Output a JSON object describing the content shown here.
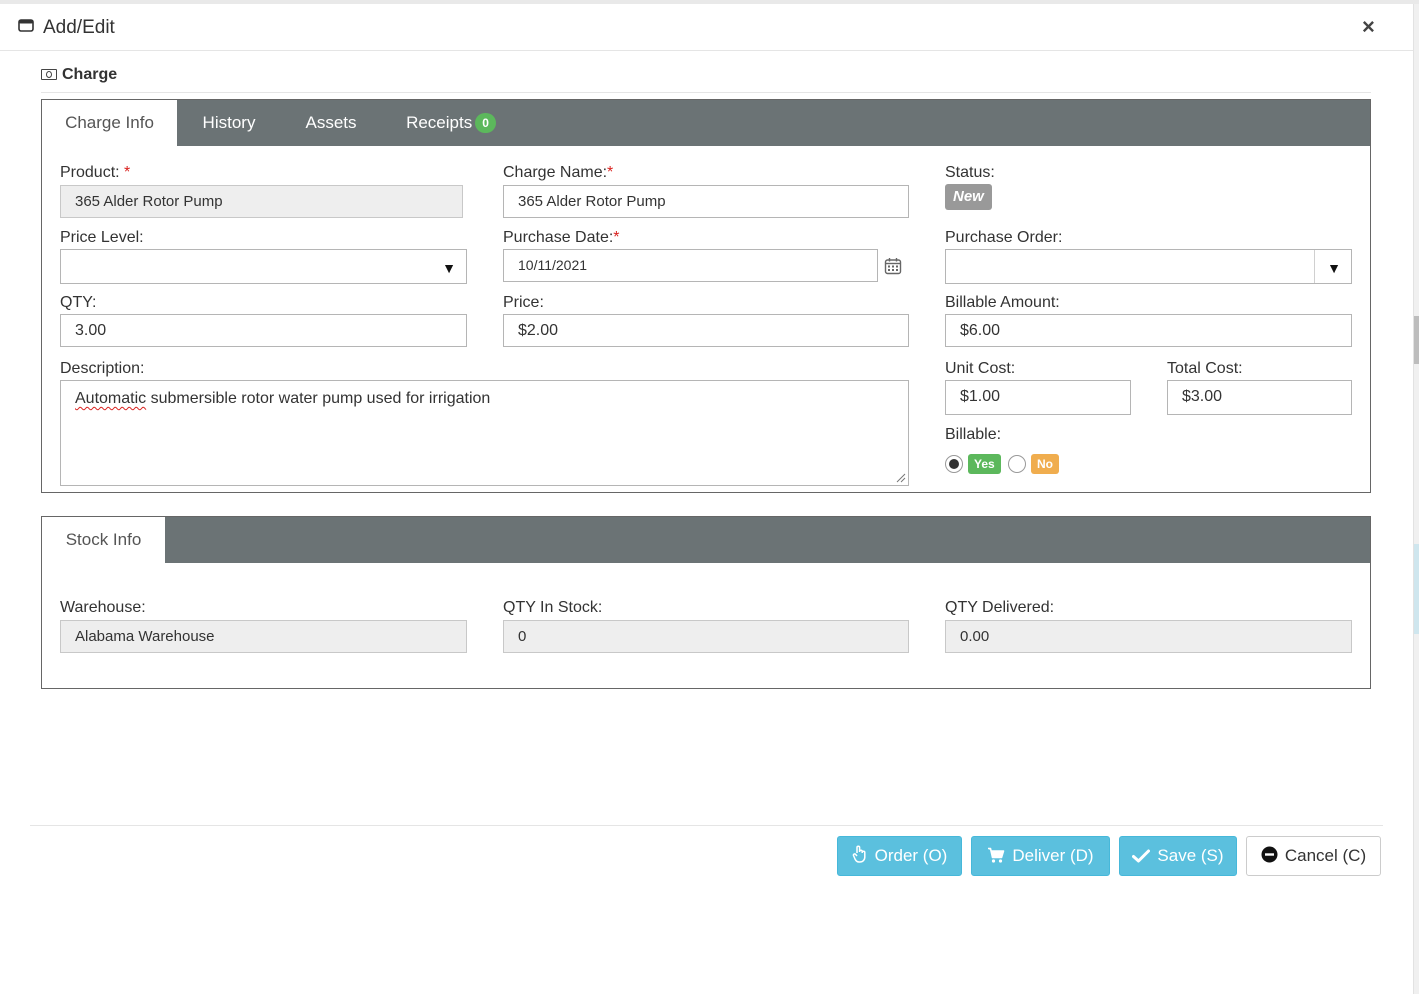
{
  "window": {
    "title": "Add/Edit",
    "close_glyph": "×",
    "icon": "window-icon"
  },
  "section": {
    "title": "Charge",
    "icon": "money-icon"
  },
  "tabs": [
    {
      "label": "Charge Info",
      "active": true
    },
    {
      "label": "History",
      "active": false
    },
    {
      "label": "Assets",
      "active": false
    },
    {
      "label": "Receipts",
      "active": false,
      "badge": "0"
    }
  ],
  "form": {
    "product": {
      "label": "Product:",
      "required": "*",
      "value": "365 Alder Rotor Pump"
    },
    "charge_name": {
      "label": "Charge Name:",
      "required": "*",
      "value": "365 Alder Rotor Pump"
    },
    "status": {
      "label": "Status:",
      "value": "New"
    },
    "price_level": {
      "label": "Price Level:",
      "value": ""
    },
    "purchase_date": {
      "label": "Purchase Date:",
      "required": "*",
      "value": "10/11/2021"
    },
    "purchase_order": {
      "label": "Purchase Order:",
      "value": ""
    },
    "qty": {
      "label": "QTY:",
      "value": "3.00"
    },
    "price": {
      "label": "Price:",
      "value": "$2.00"
    },
    "billable_amount": {
      "label": "Billable Amount:",
      "value": "$6.00"
    },
    "description": {
      "label": "Description:",
      "misspelled": "Automatic",
      "value_rest": " submersible rotor water pump used for irrigation"
    },
    "unit_cost": {
      "label": "Unit Cost:",
      "value": "$1.00"
    },
    "total_cost": {
      "label": "Total Cost:",
      "value": "$3.00"
    },
    "billable": {
      "label": "Billable:",
      "yes": "Yes",
      "no": "No",
      "selected": "Yes"
    }
  },
  "stock_tabs": [
    {
      "label": "Stock Info",
      "active": true
    }
  ],
  "stock": {
    "warehouse": {
      "label": "Warehouse:",
      "value": "Alabama Warehouse"
    },
    "qty_in_stock": {
      "label": "QTY In Stock:",
      "value": "0"
    },
    "qty_delivered": {
      "label": "QTY Delivered:",
      "value": "0.00"
    }
  },
  "buttons": {
    "order": "Order (O)",
    "deliver": "Deliver (D)",
    "save": "Save (S)",
    "cancel": "Cancel (C)"
  },
  "colors": {
    "tabbar": "#6b7375",
    "info_button": "#5bc0de",
    "badge_green": "#5cb85c",
    "badge_orange": "#f0ad4e",
    "status_gray": "#999999",
    "required_red": "#d9211e"
  }
}
